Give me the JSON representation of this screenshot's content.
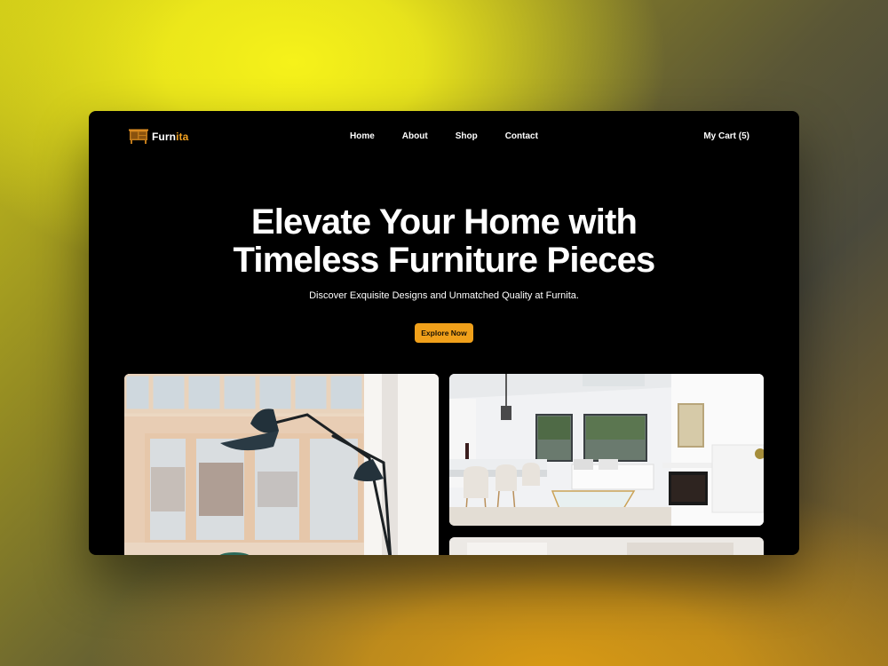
{
  "brand": {
    "name_main": "Furn",
    "name_accent": "ita",
    "accent_color": "#f0a020",
    "icon": "furniture-cabinet-icon"
  },
  "nav": {
    "links": [
      "Home",
      "About",
      "Shop",
      "Contact"
    ],
    "cart_label": "My Cart (5)"
  },
  "hero": {
    "title_line1": "Elevate Your Home with",
    "title_line2": "Timeless Furniture Pieces",
    "subtitle": "Discover Exquisite Designs and Unmatched Quality at Furnita.",
    "cta_label": "Explore Now",
    "cta_color": "#f0a01a"
  },
  "gallery": {
    "images": [
      "interior-lamp-photo",
      "living-room-kitchen-photo",
      "interior-photo"
    ]
  }
}
